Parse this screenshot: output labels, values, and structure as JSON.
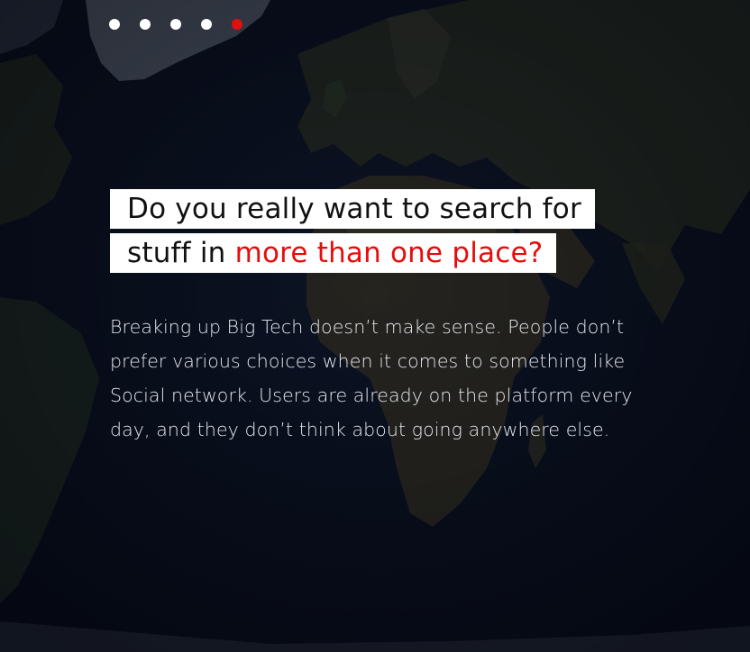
{
  "pagination": {
    "dot_count": 5,
    "active_index": 4,
    "dot_color": "#ffffff",
    "active_color": "#e10f0f"
  },
  "headline": {
    "line1": "Do you really want to search for",
    "line2_prefix": "stuff in ",
    "line2_accent": "more than one place?",
    "accent_color": "#e50d0d"
  },
  "body": {
    "line1": "Breaking up Big Tech doesn’t make sense. People don’t",
    "line2": "prefer various choices when it comes to something like",
    "line3": "Social network. Users are already on the platform every",
    "line4": "day, and they don’t think about going anywhere else."
  },
  "background": {
    "image": "world-map-satellite"
  }
}
